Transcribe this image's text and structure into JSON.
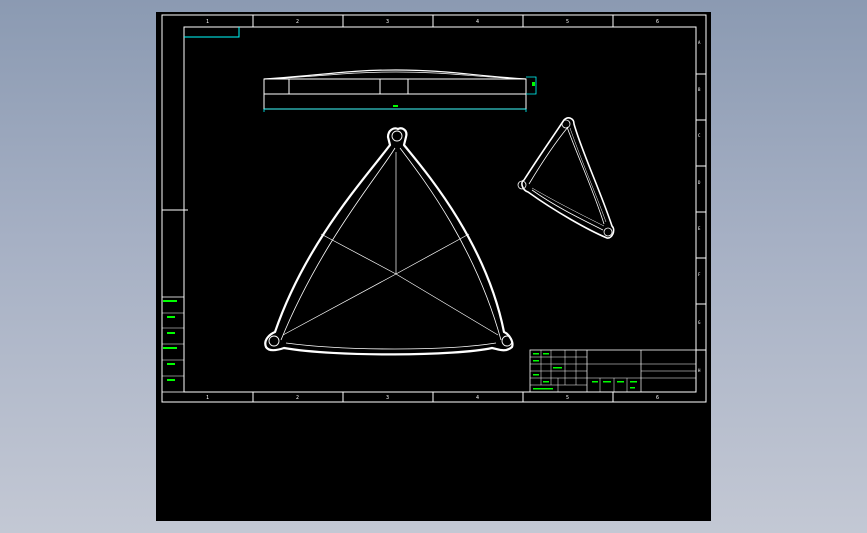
{
  "drawing": {
    "zone_columns": [
      "1",
      "2",
      "3",
      "4",
      "5",
      "6"
    ],
    "zone_rows": [
      "A",
      "B",
      "C",
      "D",
      "E",
      "F",
      "G",
      "H"
    ],
    "left_strip_labels": [
      "",
      "",
      "",
      "",
      "",
      ""
    ],
    "title_block_cells": [
      "",
      "",
      "",
      "",
      "",
      "",
      "",
      ""
    ],
    "colors": {
      "background": "#000000",
      "lines": "#ffffff",
      "dimension": "#00ffff",
      "annotation": "#00ff00"
    }
  }
}
